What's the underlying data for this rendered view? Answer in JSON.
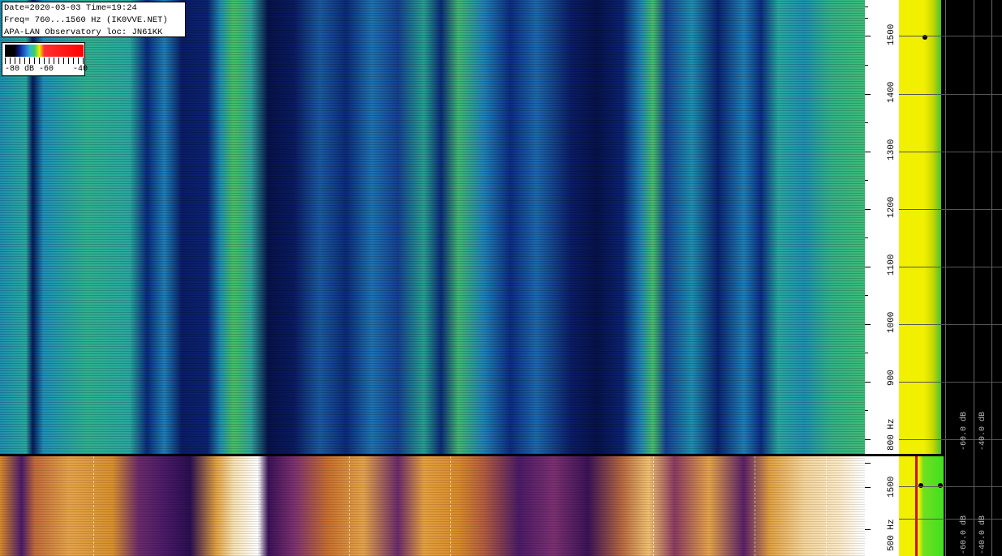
{
  "info": {
    "line1": "Date=2020-03-03 Time=19:24",
    "line2": "Freq= 760...1560 Hz (IK0VVE.NET)",
    "line3": "APA-LAN Observatory loc: JN61KK"
  },
  "legend": {
    "labels": "-80 dB -60    -40"
  },
  "top_axis": {
    "labels": [
      "1500",
      "1400",
      "1300",
      "1200",
      "1100",
      "1000",
      "900",
      "800 Hz"
    ]
  },
  "bottom_axis": {
    "labels": [
      "1500",
      "500 Hz"
    ]
  },
  "db_scale": {
    "top": [
      "-60.0 dB",
      "-40.0 dB"
    ],
    "bottom": [
      "-60.0 dB",
      "-40.0 dB"
    ]
  },
  "colors": {
    "info_bg": "#ffffff",
    "top_palette": [
      "#000000",
      "#0a1a80",
      "#2060d0",
      "#30b8d0",
      "#40d060",
      "#f0f000",
      "#ff0000"
    ],
    "bottom_palette": [
      "#2a0e50",
      "#7a3070",
      "#d88a2a",
      "#f6e0b0",
      "#ffffff"
    ],
    "spectrum": "#f0f000"
  }
}
